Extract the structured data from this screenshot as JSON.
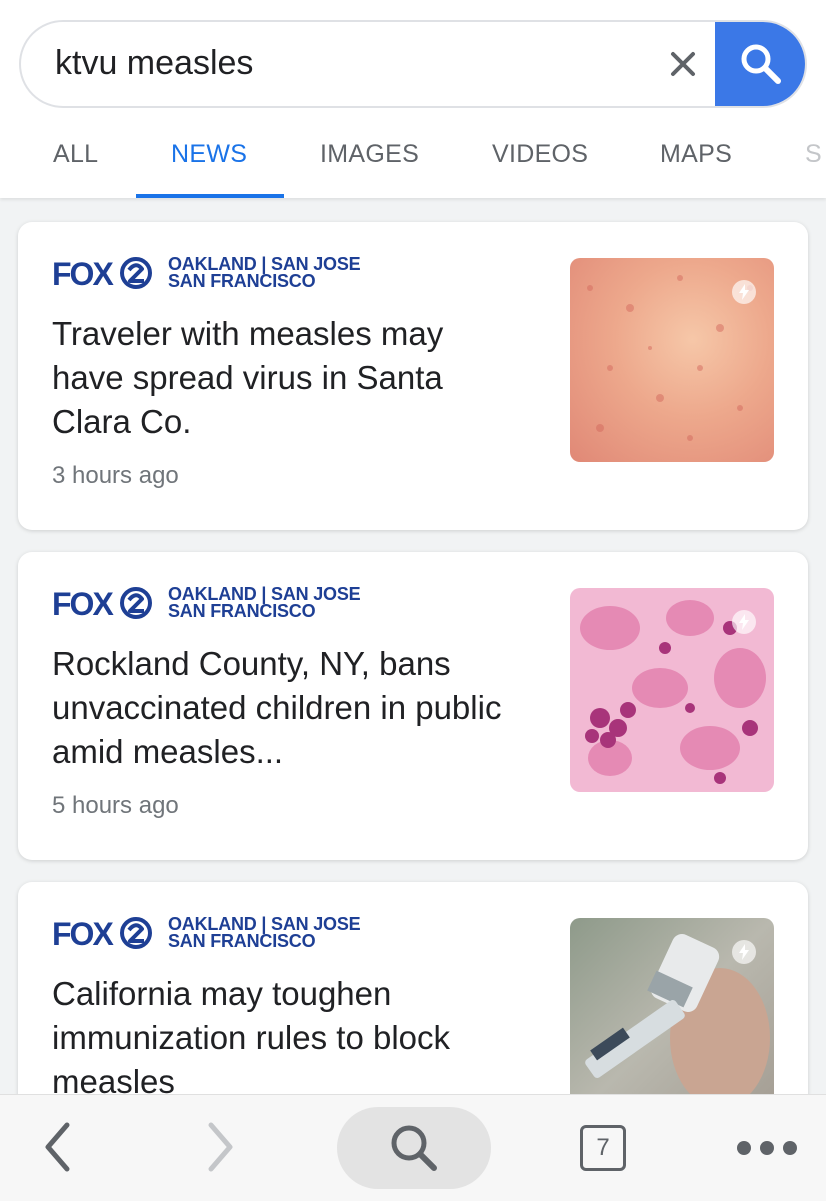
{
  "search": {
    "query": "ktvu measles"
  },
  "tabs": [
    {
      "label": "ALL"
    },
    {
      "label": "NEWS",
      "active": true
    },
    {
      "label": "IMAGES"
    },
    {
      "label": "VIDEOS"
    },
    {
      "label": "MAPS"
    },
    {
      "label": "S"
    }
  ],
  "articles": [
    {
      "source_logo": "FOX2",
      "source_name": "OAKLAND | SAN JOSE\nSAN FRANCISCO",
      "headline": "Traveler with measles may have spread virus in Santa Clara Co.",
      "time": "3 hours ago",
      "thumbnail": "rash-skin-image"
    },
    {
      "source_logo": "FOX2",
      "source_name": "OAKLAND | SAN JOSE\nSAN FRANCISCO",
      "headline": "Rockland County, NY, bans unvaccinated children in public amid measles...",
      "time": "5 hours ago",
      "thumbnail": "cells-microscope-image"
    },
    {
      "source_logo": "FOX2",
      "source_name": "OAKLAND | SAN JOSE\nSAN FRANCISCO",
      "headline": "California may toughen immunization rules to block measles",
      "time": "",
      "thumbnail": "vaccine-syringe-image"
    }
  ],
  "toolbar": {
    "tab_count": "7"
  },
  "colors": {
    "accent": "#1a73e8",
    "search_button": "#3b78e7",
    "source_blue": "#1e3f95"
  }
}
